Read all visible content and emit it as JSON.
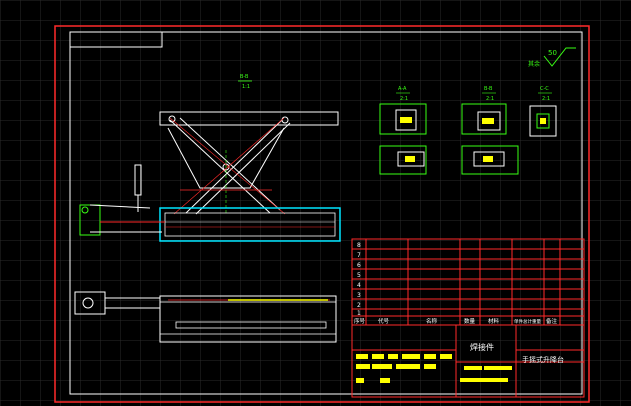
{
  "drawing": {
    "title_main": "手摇式升降台",
    "title_weld": "焊接件",
    "roughness_value": "50",
    "roughness_label": "其余",
    "section_main": "B-B",
    "section_main_scale": "1:1",
    "section_a": "A-A",
    "section_a_scale": "2:1",
    "section_b": "B-B",
    "section_b_scale": "2:1",
    "section_c": "C-C",
    "section_c_scale": "2:1"
  },
  "bom": {
    "row_numbers": [
      "8",
      "7",
      "6",
      "5",
      "4",
      "3",
      "2",
      "1"
    ],
    "headers": [
      "序号",
      "代号",
      "名称",
      "数量",
      "材料",
      "单件总计重量",
      "备注"
    ]
  },
  "colors": {
    "background": "#000000",
    "grid": "#2a2a2a",
    "frame": "#ff2a2a",
    "outline": "#ffffff",
    "green": "#39ff14",
    "cyan": "#00e5ff",
    "yellow": "#ffff00",
    "red": "#ff2a2a"
  }
}
